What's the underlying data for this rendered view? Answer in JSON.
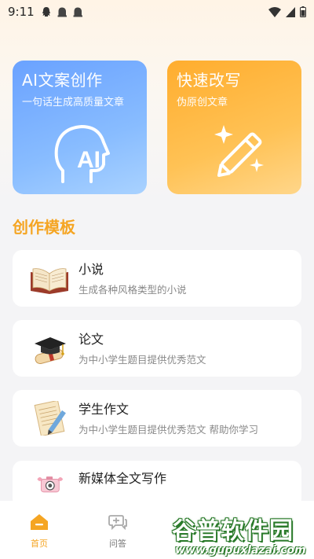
{
  "status_bar": {
    "time": "9:11",
    "icons": [
      "qq-icon",
      "ghost-icon",
      "ghost-icon",
      "wifi-icon",
      "signal-icon",
      "battery-icon"
    ]
  },
  "feature_cards": [
    {
      "title": "AI文案创作",
      "subtitle": "一句话生成高质量文章",
      "icon": "ai-head-icon",
      "color": "#6aa2ff"
    },
    {
      "title": "快速改写",
      "subtitle": "伪原创文章",
      "icon": "magic-pencil-icon",
      "color": "#ffad2e"
    }
  ],
  "templates_section": {
    "title": "创作模板",
    "items": [
      {
        "name": "小说",
        "desc": "生成各种风格类型的小说",
        "icon": "open-book-icon"
      },
      {
        "name": "论文",
        "desc": "为中小学生题目提供优秀范文",
        "icon": "graduation-cap-icon"
      },
      {
        "name": "学生作文",
        "desc": "为中小学生题目提供优秀范文 帮助你学习",
        "icon": "paper-pen-icon"
      },
      {
        "name": "新媒体全文写作",
        "desc": "",
        "icon": "camera-icon"
      }
    ]
  },
  "bottom_nav": {
    "items": [
      {
        "label": "首页",
        "icon": "home-icon",
        "active": true
      },
      {
        "label": "问答",
        "icon": "chat-icon",
        "active": false
      }
    ],
    "active_color": "#f5a523"
  },
  "watermark": {
    "main": "谷普软件园",
    "url": "www.gupuxlazai.com"
  }
}
